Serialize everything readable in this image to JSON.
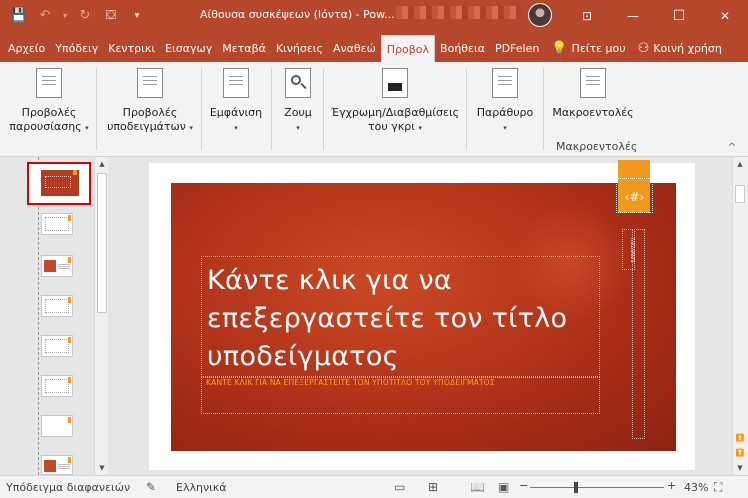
{
  "titlebar": {
    "title": "Αίθουσα συσκέψεων (Ιόντα)  -  Pow..."
  },
  "tabs": [
    {
      "label": "Αρχείο"
    },
    {
      "label": "Υπόδειγ"
    },
    {
      "label": "Κεντρικι"
    },
    {
      "label": "Εισαγωγ"
    },
    {
      "label": "Μεταβά"
    },
    {
      "label": "Κινήσεις"
    },
    {
      "label": "Αναθεώ"
    },
    {
      "label": "Προβολ"
    },
    {
      "label": "Βοήθεια"
    },
    {
      "label": "PDFelen"
    },
    {
      "label": "Πείτε μου"
    },
    {
      "label": "Κοινή χρήση"
    }
  ],
  "ribbon": {
    "items": [
      {
        "line1": "Προβολές",
        "line2": "παρουσίασης"
      },
      {
        "line1": "Προβολές",
        "line2": "υποδειγμάτων"
      },
      {
        "line1": "Εμφάνιση",
        "line2": ""
      },
      {
        "line1": "Ζουμ",
        "line2": ""
      },
      {
        "line1": "Έγχρωμη/Διαβαθμίσεις",
        "line2": "του γκρι"
      },
      {
        "line1": "Παράθυρο",
        "line2": ""
      },
      {
        "line1": "Μακροεντολές",
        "line2": ""
      }
    ],
    "group_label": "Μακροεντολές"
  },
  "slide": {
    "title": "Κάντε κλικ για να επεξεργαστείτε τον τίτλο υποδείγματος",
    "subtitle": "ΚΑΝΤΕ ΚΛΙΚ ΓΙΑ ΝΑ ΕΠΕΞΕΡΓΑΣΤΕΙΤΕ ΤΟΝ ΥΠΟΤΙΤΛΟ ΤΟΥ ΥΠΟΔΕΙΓΜΑΤΟΣ",
    "number": "‹#›",
    "date": "7/22/2021"
  },
  "status": {
    "view": "Υπόδειγμα διαφανειών",
    "language": "Ελληνικά",
    "zoom": "43%",
    "zoom_fraction": 0.43
  },
  "colors": {
    "brand": "#b7472a",
    "accent": "#f29a1e"
  }
}
